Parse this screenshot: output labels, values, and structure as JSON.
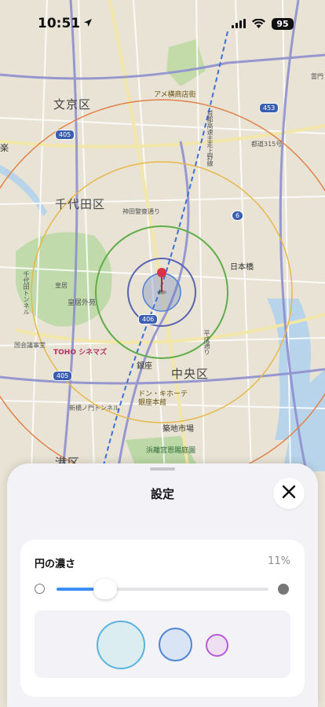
{
  "status_bar": {
    "time": "10:51",
    "battery": "95"
  },
  "map": {
    "places": [
      {
        "label": "文京区"
      },
      {
        "label": "千代田区"
      },
      {
        "label": "中央区"
      },
      {
        "label": "日本橋"
      },
      {
        "label": "銀座"
      },
      {
        "label": "築地市場"
      },
      {
        "label": "港区"
      },
      {
        "label": "楽"
      },
      {
        "label": "雷門"
      },
      {
        "label": "都道315号"
      },
      {
        "label": "神田警察通り"
      },
      {
        "label": "首都高速主走上野線"
      },
      {
        "label": "千代田トンネル"
      },
      {
        "label": "皇居"
      },
      {
        "label": "皇居外苑"
      },
      {
        "label": "国会議事堂"
      },
      {
        "label": "新橋ノ門トンネル"
      },
      {
        "label": "平成通り"
      }
    ],
    "pois": [
      {
        "label": "アメ横商店街"
      },
      {
        "label": "TOHO シネマズ"
      },
      {
        "label": "ドン・キホーテ 銀座本館"
      },
      {
        "label": "浜離宮恩賜庭園"
      }
    ],
    "shields": [
      "405",
      "453",
      "6",
      "406",
      "405"
    ],
    "circle_colors": [
      "#e0824a",
      "#e6b84a",
      "#5fae4a",
      "#5a62b4",
      "#4a7fd6"
    ],
    "pin_color": "#d8334a"
  },
  "sheet": {
    "title": "設定",
    "close_icon": "xmark-icon",
    "opacity": {
      "label": "円の濃さ",
      "value_text": "11%",
      "value": 0.11,
      "min_icon": "circle-outline-icon",
      "max_icon": "circle-filled-icon"
    },
    "size_options": [
      "large-circle",
      "medium-circle",
      "small-circle"
    ]
  }
}
